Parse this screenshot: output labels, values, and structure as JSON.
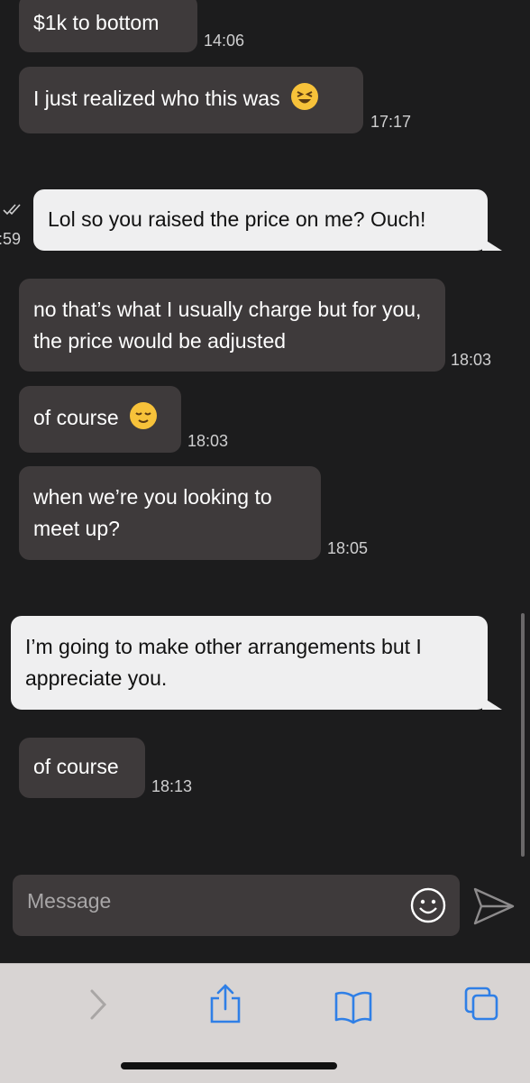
{
  "messages": [
    {
      "text": "$1k to bottom",
      "time": "14:06",
      "direction": "incoming"
    },
    {
      "text": "I just realized who this was",
      "emoji": "laughing-squint-emoji",
      "time": "17:17",
      "direction": "incoming"
    },
    {
      "text": "Lol so you raised the price on me? Ouch!",
      "time": ":59",
      "direction": "outgoing",
      "status": "read"
    },
    {
      "text": "no that’s what I usually charge but for you, the price would be adjusted",
      "time": "18:03",
      "direction": "incoming"
    },
    {
      "text": "of course",
      "emoji": "relieved-face-emoji",
      "time": "18:03",
      "direction": "incoming"
    },
    {
      "text": "when we’re you looking to meet up?",
      "time": "18:05",
      "direction": "incoming"
    },
    {
      "text": "I’m going to make other arrangements but I appreciate you.",
      "time": "",
      "direction": "outgoing"
    },
    {
      "text": "of course",
      "time": "18:13",
      "direction": "incoming"
    }
  ],
  "composer": {
    "placeholder": "Message",
    "emoji_icon": "smiley-icon",
    "send_icon": "send-arrow-icon"
  },
  "browser_toolbar": {
    "icons": [
      "forward-chevron-icon",
      "share-icon",
      "bookmarks-icon",
      "tabs-icon"
    ]
  },
  "colors": {
    "background": "#1c1c1d",
    "incoming_bubble": "#3e3a3b",
    "outgoing_bubble": "#efeff0",
    "toolbar": "#d8d4d3",
    "accent": "#2f7fe6"
  }
}
